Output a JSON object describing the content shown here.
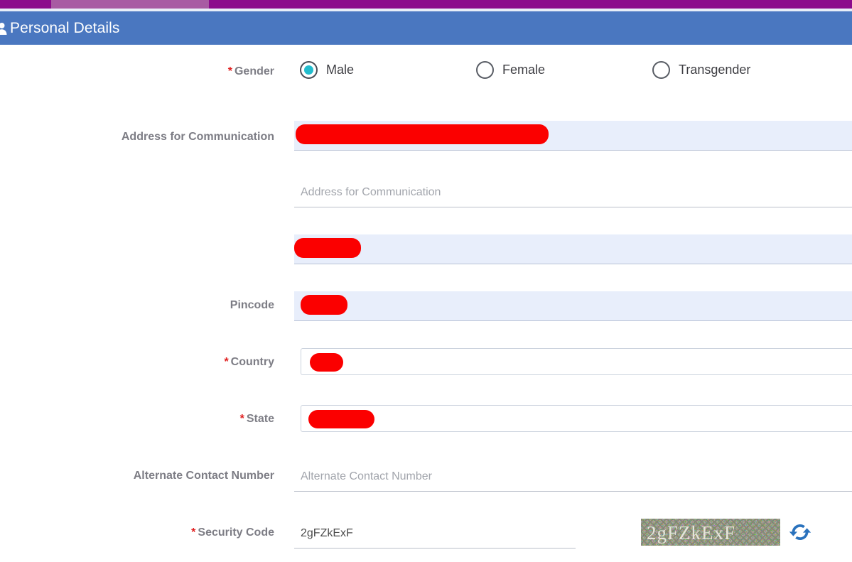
{
  "top_strip": {
    "bar_color": "#8c0b8c",
    "tab_color": "#a85ba3"
  },
  "section_header": {
    "icon": "person-icon",
    "title": "Personal Details",
    "background": "#4a77c0",
    "text_color": "#ffffff"
  },
  "form": {
    "gender": {
      "label": "Gender",
      "required": true,
      "options": [
        {
          "label": "Male",
          "selected": true
        },
        {
          "label": "Female",
          "selected": false
        },
        {
          "label": "Transgender",
          "selected": false
        }
      ],
      "selected_color": "#22bccd"
    },
    "address": {
      "label": "Address for Communication",
      "required": false,
      "line1": {
        "value": "",
        "redacted": true,
        "autofilled": true
      },
      "line2": {
        "value": "",
        "placeholder": "Address for Communication",
        "autofilled": false
      },
      "line3": {
        "value": "",
        "redacted": true,
        "autofilled": true
      }
    },
    "pincode": {
      "label": "Pincode",
      "required": false,
      "value": "",
      "redacted": true,
      "autofilled": true
    },
    "country": {
      "label": "Country",
      "required": true,
      "value": "",
      "redacted": true,
      "control": "select"
    },
    "state": {
      "label": "State",
      "required": true,
      "value": "",
      "redacted": true,
      "control": "select"
    },
    "alternate_contact": {
      "label": "Alternate Contact Number",
      "required": false,
      "value": "",
      "placeholder": "Alternate Contact Number"
    },
    "security_code": {
      "label": "Security Code",
      "required": true,
      "value": "2gFZkExF",
      "captcha_text": "2gFZkExF",
      "refresh_icon": "refresh-icon",
      "refresh_color": "#2a72bd"
    }
  },
  "colors": {
    "required_asterisk": "#e02020",
    "label_text": "#7d7d85",
    "autofill_background": "#e8eefb",
    "redaction": "#fb0000",
    "field_underline": "#b9bfc9"
  }
}
